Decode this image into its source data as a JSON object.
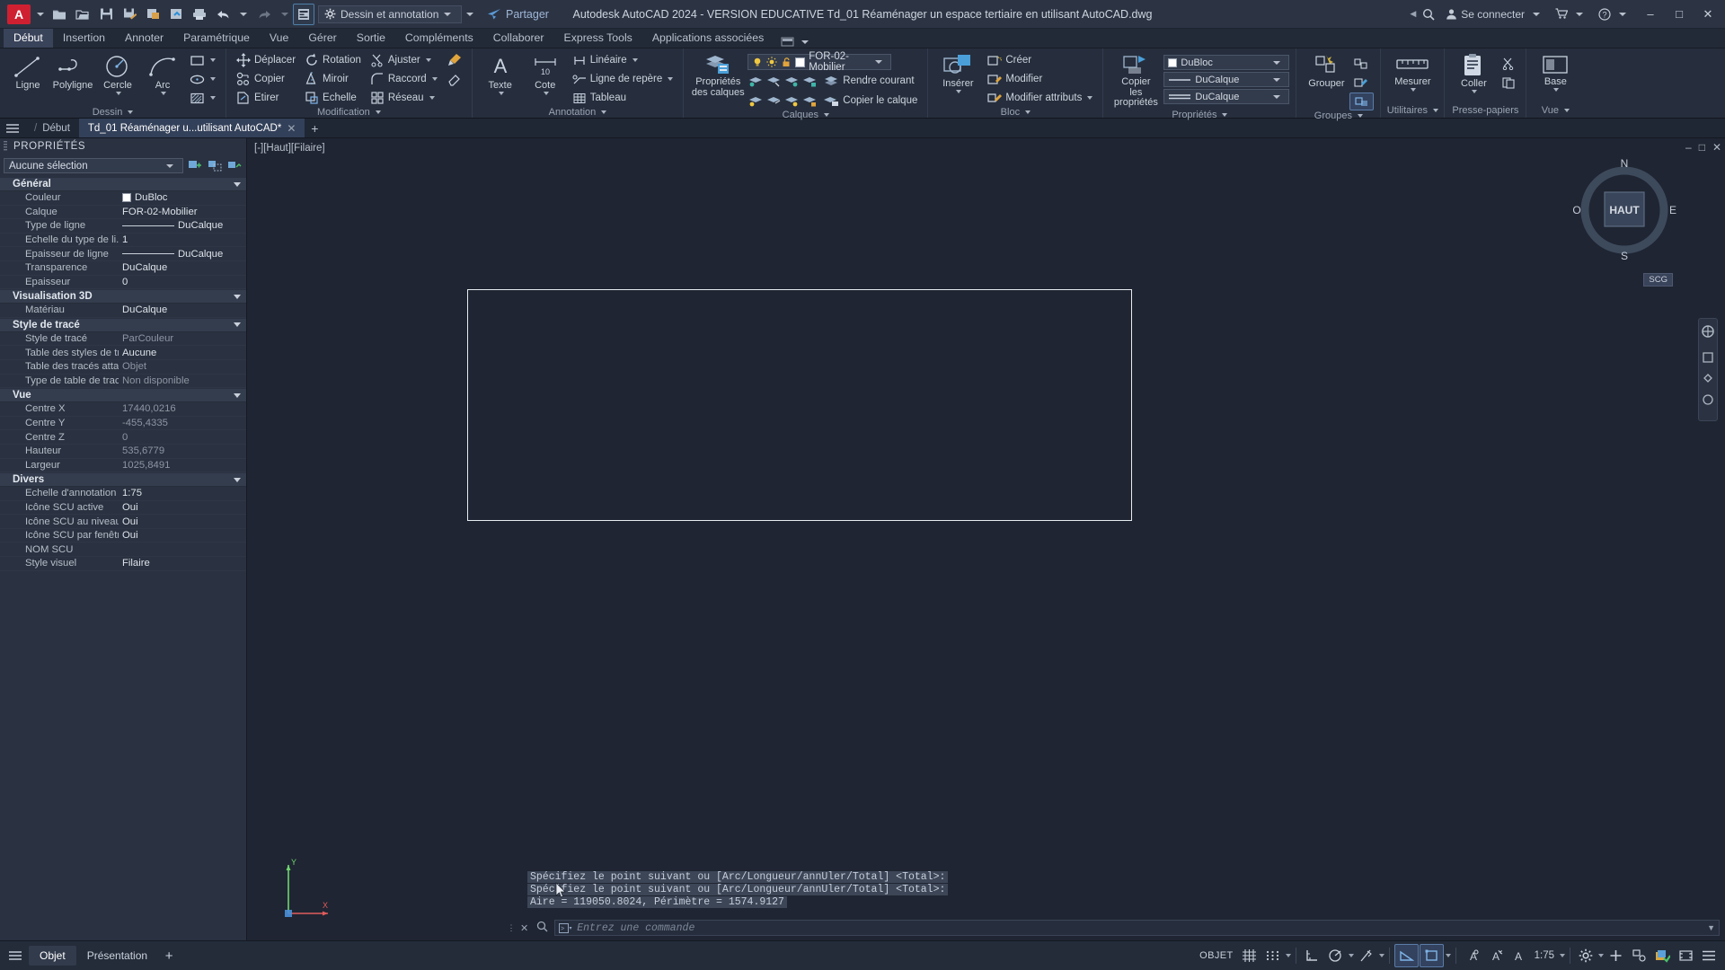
{
  "titlebar": {
    "logo": "A",
    "workspace": "Dessin et annotation",
    "share_label": "Partager",
    "app_title": "Autodesk AutoCAD 2024 - VERSION EDUCATIVE   Td_01 Réaménager un espace tertiaire en utilisant AutoCAD.dwg",
    "signin_label": "Se connecter",
    "quick_access": [
      {
        "name": "new-icon",
        "tip": "Nouveau"
      },
      {
        "name": "open-icon",
        "tip": "Ouvrir"
      },
      {
        "name": "save-icon",
        "tip": "Enregistrer"
      },
      {
        "name": "save-as-icon",
        "tip": "Enregistrer sous"
      },
      {
        "name": "export-icon",
        "tip": "Exporter"
      },
      {
        "name": "cloud-save-icon",
        "tip": "Enregistrer dans le web"
      },
      {
        "name": "print-icon",
        "tip": "Tracer"
      },
      {
        "name": "undo-icon",
        "tip": "Annuler"
      },
      {
        "name": "redo-icon",
        "tip": "Rétablir"
      }
    ]
  },
  "ribbon_tabs": [
    {
      "label": "Début",
      "active": true
    },
    {
      "label": "Insertion",
      "active": false
    },
    {
      "label": "Annoter",
      "active": false
    },
    {
      "label": "Paramétrique",
      "active": false
    },
    {
      "label": "Vue",
      "active": false
    },
    {
      "label": "Gérer",
      "active": false
    },
    {
      "label": "Sortie",
      "active": false
    },
    {
      "label": "Compléments",
      "active": false
    },
    {
      "label": "Collaborer",
      "active": false
    },
    {
      "label": "Express Tools",
      "active": false
    },
    {
      "label": "Applications associées",
      "active": false
    }
  ],
  "ribbon": {
    "dessin": {
      "title": "Dessin",
      "big": [
        {
          "label": "Ligne",
          "icon": "line-icon"
        },
        {
          "label": "Polyligne",
          "icon": "polyline-icon"
        },
        {
          "label": "Cercle",
          "icon": "circle-icon"
        },
        {
          "label": "Arc",
          "icon": "arc-icon"
        }
      ],
      "small": [
        {
          "label": "",
          "icon": "rectangle-icon"
        },
        {
          "label": "",
          "icon": "ellipse-icon"
        },
        {
          "label": "",
          "icon": "hatch-icon"
        }
      ]
    },
    "modification": {
      "title": "Modification",
      "col1": [
        {
          "label": "Déplacer",
          "icon": "move-icon"
        },
        {
          "label": "Copier",
          "icon": "copy-icon"
        },
        {
          "label": "Etirer",
          "icon": "stretch-icon"
        }
      ],
      "col2": [
        {
          "label": "Rotation",
          "icon": "rotate-icon"
        },
        {
          "label": "Miroir",
          "icon": "mirror-icon"
        },
        {
          "label": "Echelle",
          "icon": "scale-icon"
        }
      ],
      "col3": [
        {
          "label": "Ajuster",
          "icon": "trim-icon"
        },
        {
          "label": "Raccord",
          "icon": "fillet-icon"
        },
        {
          "label": "Réseau",
          "icon": "array-icon"
        }
      ],
      "extra": [
        {
          "label": "",
          "icon": "paint-brush-icon"
        },
        {
          "label": "",
          "icon": "erase-icon"
        }
      ]
    },
    "annotation": {
      "title": "Annotation",
      "big": [
        {
          "label": "Texte",
          "icon": "text-icon"
        },
        {
          "label": "Cote",
          "icon": "dimension-icon"
        }
      ],
      "small": [
        {
          "label": "Linéaire",
          "icon": "linear-dim-icon"
        },
        {
          "label": "Ligne de repère",
          "icon": "leader-icon"
        },
        {
          "label": "Tableau",
          "icon": "table-icon"
        }
      ]
    },
    "calques": {
      "title": "Calques",
      "big": {
        "label": "Propriétés\ndes calques",
        "line1": "Propriétés",
        "line2": "des calques",
        "icon": "layer-properties-icon"
      },
      "current_layer": "FOR-02-Mobilier",
      "small": [
        {
          "label": "Rendre courant",
          "icon": "make-current-icon"
        },
        {
          "label": "Copier le calque",
          "icon": "copy-layer-icon"
        }
      ],
      "toggles": [
        "lightbulb-icon",
        "sun-icon",
        "unlock-icon",
        "color-swatch-icon"
      ]
    },
    "bloc": {
      "title": "Bloc",
      "big": {
        "label": "Insérer",
        "icon": "insert-block-icon"
      },
      "small": [
        {
          "label": "Créer",
          "icon": "create-block-icon"
        },
        {
          "label": "Modifier",
          "icon": "edit-block-icon"
        },
        {
          "label": "Modifier attributs",
          "icon": "edit-attributes-icon"
        }
      ]
    },
    "proprietes": {
      "title": "Propriétés",
      "big": {
        "line1": "Copier",
        "line2": "les propriétés",
        "icon": "match-properties-icon"
      },
      "combos": [
        {
          "value": "DuBloc",
          "icon": "color-icon"
        },
        {
          "value": "DuCalque",
          "icon": "lineweight-icon"
        },
        {
          "value": "DuCalque",
          "icon": "linetype-icon"
        }
      ]
    },
    "groupes": {
      "title": "Groupes",
      "label": "Grouper",
      "icon": "group-icon"
    },
    "utilitaires": {
      "title": "Utilitaires",
      "label": "Mesurer",
      "icon": "measure-icon"
    },
    "presse_papiers": {
      "title": "Presse-papiers",
      "label": "Coller",
      "icon": "paste-icon"
    },
    "vue": {
      "title": "Vue",
      "label": "Base",
      "icon": "base-view-icon"
    }
  },
  "filetabs": {
    "start_label": "Début",
    "tabs": [
      {
        "label": "Td_01 Réaménager u...utilisant AutoCAD*",
        "active": true
      }
    ],
    "add_label": "+"
  },
  "properties_palette": {
    "header": "PROPRIÉTÉS",
    "selection": "Aucune sélection",
    "buttons": [
      "quick-select-icon",
      "select-all-icon",
      "pickadd-icon"
    ],
    "groups": [
      {
        "name": "Général",
        "rows": [
          {
            "key": "Couleur",
            "value": "DuBloc",
            "swatch": true
          },
          {
            "key": "Calque",
            "value": "FOR-02-Mobilier"
          },
          {
            "key": "Type de ligne",
            "value": "DuCalque",
            "line": true
          },
          {
            "key": "Echelle du type de li...",
            "value": "1"
          },
          {
            "key": "Epaisseur de ligne",
            "value": "DuCalque",
            "line": true
          },
          {
            "key": "Transparence",
            "value": "DuCalque"
          },
          {
            "key": "Epaisseur",
            "value": "0"
          }
        ]
      },
      {
        "name": "Visualisation 3D",
        "rows": [
          {
            "key": "Matériau",
            "value": "DuCalque"
          }
        ]
      },
      {
        "name": "Style de tracé",
        "rows": [
          {
            "key": "Style de tracé",
            "value": "ParCouleur",
            "dim": true
          },
          {
            "key": "Table des styles de tr...",
            "value": "Aucune"
          },
          {
            "key": "Table des tracés atta...",
            "value": "Objet",
            "dim": true
          },
          {
            "key": "Type de table de tracé",
            "value": "Non disponible",
            "dim": true
          }
        ]
      },
      {
        "name": "Vue",
        "rows": [
          {
            "key": "Centre X",
            "value": "17440,0216",
            "dim": true
          },
          {
            "key": "Centre Y",
            "value": "-455,4335",
            "dim": true
          },
          {
            "key": "Centre Z",
            "value": "0",
            "dim": true
          },
          {
            "key": "Hauteur",
            "value": "535,6779",
            "dim": true
          },
          {
            "key": "Largeur",
            "value": "1025,8491",
            "dim": true
          }
        ]
      },
      {
        "name": "Divers",
        "rows": [
          {
            "key": "Echelle d'annotation",
            "value": "1:75"
          },
          {
            "key": "Icône SCU active",
            "value": "Oui"
          },
          {
            "key": "Icône SCU au niveau...",
            "value": "Oui"
          },
          {
            "key": "Icône SCU par fenêtre",
            "value": "Oui"
          },
          {
            "key": "NOM SCU",
            "value": ""
          },
          {
            "key": "Style visuel",
            "value": "Filaire"
          }
        ]
      }
    ]
  },
  "canvas": {
    "viewport_label": "[-][Haut][Filaire]",
    "navcube": {
      "top": "HAUT",
      "north": "N",
      "south": "S",
      "east": "E",
      "west": "O"
    },
    "scu_badge": "SCG",
    "ucs_axes": {
      "x": "X",
      "y": "Y"
    },
    "command_history": [
      "Spécifiez le point suivant ou [Arc/Longueur/annUler/Total] <Total>:",
      "Spécifiez le point suivant ou [Arc/Longueur/annUler/Total] <Total>:",
      "Aire = 119050.8024, Périmètre = 1574.9127"
    ]
  },
  "command_bar": {
    "placeholder": "Entrez une commande",
    "prompt_icon": "command-prompt-icon"
  },
  "statusbar": {
    "layout_tabs": [
      {
        "label": "Objet",
        "active": true
      },
      {
        "label": "Présentation",
        "active": false
      }
    ],
    "add_label": "+",
    "model_label": "OBJET",
    "annotation_scale": "1:75",
    "items": [
      {
        "name": "grid-icon",
        "on": false
      },
      {
        "name": "snap-icon",
        "on": false
      },
      {
        "name": "ortho-icon",
        "on": false
      },
      {
        "name": "polar-tracking-icon",
        "on": false
      },
      {
        "name": "object-snap-icon",
        "on": false
      },
      {
        "name": "angle-constraint-icon",
        "on": true
      },
      {
        "name": "dynamic-ucs-icon",
        "on": true
      },
      {
        "name": "annotation-visibility-icon",
        "on": false
      },
      {
        "name": "autoscale-icon",
        "on": false
      },
      {
        "name": "annotation-monitor-icon",
        "on": false
      },
      {
        "name": "workspace-gear-icon",
        "on": false
      },
      {
        "name": "isolate-objects-icon",
        "on": false
      },
      {
        "name": "hardware-accel-icon",
        "on": false
      },
      {
        "name": "clean-screen-icon",
        "on": false
      },
      {
        "name": "customization-icon",
        "on": false
      }
    ]
  },
  "colors": {
    "accent": "#5b7ca8",
    "logo_red": "#cf2031",
    "canvas_bg": "#1f2532",
    "panel_bg": "#262e3d"
  }
}
